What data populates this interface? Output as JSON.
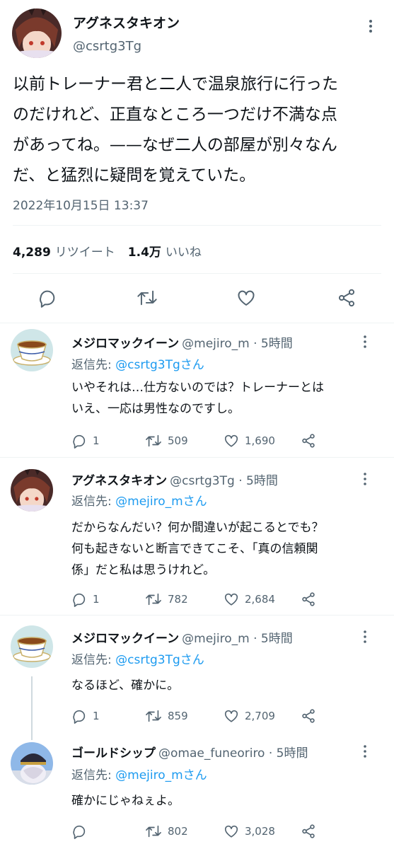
{
  "main_tweet": {
    "display_name": "アグネスタキオン",
    "handle": "@csrtg3Tg",
    "text": "以前トレーナー君と二人で温泉旅行に行った\nのだけれど、正直なところ一つだけ不満な点\nがあってね。——なぜ二人の部屋が別々なん\nだ、と猛烈に疑問を覚えていた。",
    "timestamp": "2022年10月15日 13:37",
    "retweet_count": "4,289",
    "retweet_label": "リツイート",
    "like_count": "1.4万",
    "like_label": "いいね"
  },
  "reply_prefix": "返信先:",
  "replies": [
    {
      "display_name": "メジロマックイーン",
      "handle": "@mejiro_m · 5時間",
      "reply_to": "@csrtg3Tgさん",
      "text": "いやそれは…仕方ないのでは？トレーナーとは\nいえ、一応は男性なのですし。",
      "reply_count": "1",
      "retweet_count": "509",
      "like_count": "1,690"
    },
    {
      "display_name": "アグネスタキオン",
      "handle": "@csrtg3Tg · 5時間",
      "reply_to": "@mejiro_mさん",
      "text": "だからなんだい？何か間違いが起こるとでも？\n何も起きないと断言できてこそ、「真の信頼関\n係」だと私は思うけれど。",
      "reply_count": "1",
      "retweet_count": "782",
      "like_count": "2,684"
    },
    {
      "display_name": "メジロマックイーン",
      "handle": "@mejiro_m · 5時間",
      "reply_to": "@csrtg3Tgさん",
      "text": "なるほど、確かに。",
      "reply_count": "1",
      "retweet_count": "859",
      "like_count": "2,709"
    },
    {
      "display_name": "ゴールドシップ",
      "handle": "@omae_funeoriro · 5時間",
      "reply_to": "@mejiro_mさん",
      "text": "確かにじゃねぇよ。",
      "reply_count": "",
      "retweet_count": "802",
      "like_count": "3,028"
    }
  ],
  "icons": {
    "more": "more-vertical-icon",
    "reply": "reply-icon",
    "retweet": "retweet-icon",
    "like": "heart-icon",
    "share": "share-icon"
  },
  "colors": {
    "text": "#0f1419",
    "muted": "#536471",
    "link": "#1d9bf0",
    "divider": "#eff3f4"
  }
}
